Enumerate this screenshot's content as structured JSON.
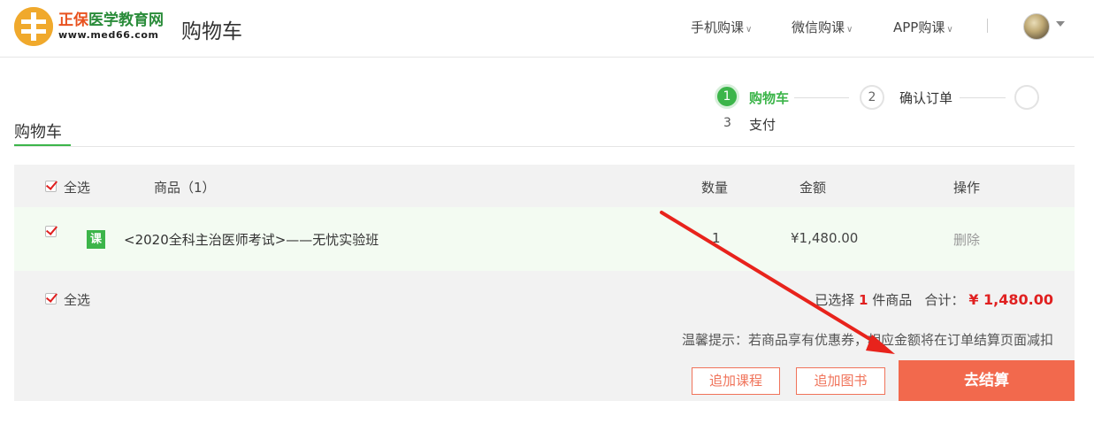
{
  "brand": {
    "name_a": "正保",
    "name_b": "医学教育网",
    "url": "www.med66.com",
    "logo_color": "#f0a92c"
  },
  "page_title": "购物车",
  "nav": [
    {
      "label": "手机购课"
    },
    {
      "label": "微信购课"
    },
    {
      "label": "APP购课"
    }
  ],
  "steps": [
    {
      "num": "1",
      "label": "购物车",
      "active": true
    },
    {
      "num": "2",
      "label": "确认订单",
      "active": false
    },
    {
      "num": "3",
      "label": "支付",
      "active": false
    }
  ],
  "cart": {
    "title": "购物车",
    "header": {
      "select_all": "全选",
      "product": "商品（1）",
      "quantity": "数量",
      "amount": "金额",
      "action": "操作"
    },
    "items": [
      {
        "badge": "课",
        "name": "<2020全科主治医师考试>——无忧实验班",
        "quantity": "1",
        "price": "¥1,480.00",
        "action": "删除",
        "checked": true
      }
    ],
    "footer": {
      "select_all": "全选",
      "selected_prefix": "已选择",
      "selected_count": "1",
      "selected_suffix": "件商品",
      "total_label": "合计：",
      "total_value": "¥ 1,480.00",
      "tip": "温馨提示：若商品享有优惠券，相应金额将在订单结算页面减扣",
      "add_course": "追加课程",
      "add_book": "追加图书",
      "checkout": "去结算"
    }
  },
  "colors": {
    "accent_green": "#3cb54a",
    "checkout_orange": "#f2694d",
    "price_red": "#e02020"
  }
}
